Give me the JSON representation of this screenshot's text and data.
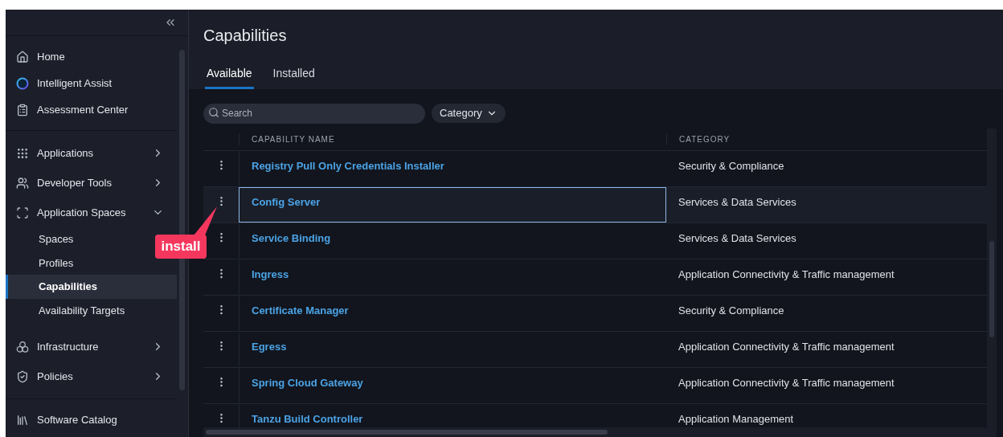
{
  "sidebar": {
    "sections": [
      {
        "items": [
          {
            "label": "Home",
            "selected": false
          },
          {
            "label": "Intelligent Assist",
            "selected": false
          },
          {
            "label": "Assessment Center",
            "selected": false
          }
        ]
      },
      {
        "items": [
          {
            "label": "Applications",
            "selected": false,
            "expanded": false
          },
          {
            "label": "Developer Tools",
            "selected": false,
            "expanded": false
          },
          {
            "label": "Application Spaces",
            "selected": false,
            "expanded": true,
            "children": [
              {
                "label": "Spaces",
                "selected": false
              },
              {
                "label": "Profiles",
                "selected": false
              },
              {
                "label": "Capabilities",
                "selected": true
              },
              {
                "label": "Availability Targets",
                "selected": false
              }
            ]
          },
          {
            "label": "Infrastructure",
            "selected": false,
            "expanded": false
          },
          {
            "label": "Policies",
            "selected": false,
            "expanded": false
          }
        ]
      },
      {
        "items": [
          {
            "label": "Software Catalog",
            "selected": false
          }
        ]
      }
    ]
  },
  "page": {
    "title": "Capabilities"
  },
  "tabs": [
    {
      "label": "Available",
      "selected": true
    },
    {
      "label": "Installed",
      "selected": false
    }
  ],
  "search": {
    "placeholder": "Search"
  },
  "filter": {
    "label": "Category"
  },
  "table": {
    "columns": [
      "CAPABILITY NAME",
      "CATEGORY"
    ],
    "rows": [
      {
        "name": "Registry Pull Only Credentials Installer",
        "category": "Security & Compliance",
        "selected": false
      },
      {
        "name": "Config Server",
        "category": "Services & Data Services",
        "selected": true
      },
      {
        "name": "Service Binding",
        "category": "Services & Data Services",
        "selected": false
      },
      {
        "name": "Ingress",
        "category": "Application Connectivity & Traffic management",
        "selected": false
      },
      {
        "name": "Certificate Manager",
        "category": "Security & Compliance",
        "selected": false
      },
      {
        "name": "Egress",
        "category": "Application Connectivity & Traffic management",
        "selected": false
      },
      {
        "name": "Spring Cloud Gateway",
        "category": "Application Connectivity & Traffic management",
        "selected": false
      },
      {
        "name": "Tanzu Build Controller",
        "category": "Application Management",
        "selected": false
      }
    ]
  },
  "annotation": {
    "text": "install"
  }
}
